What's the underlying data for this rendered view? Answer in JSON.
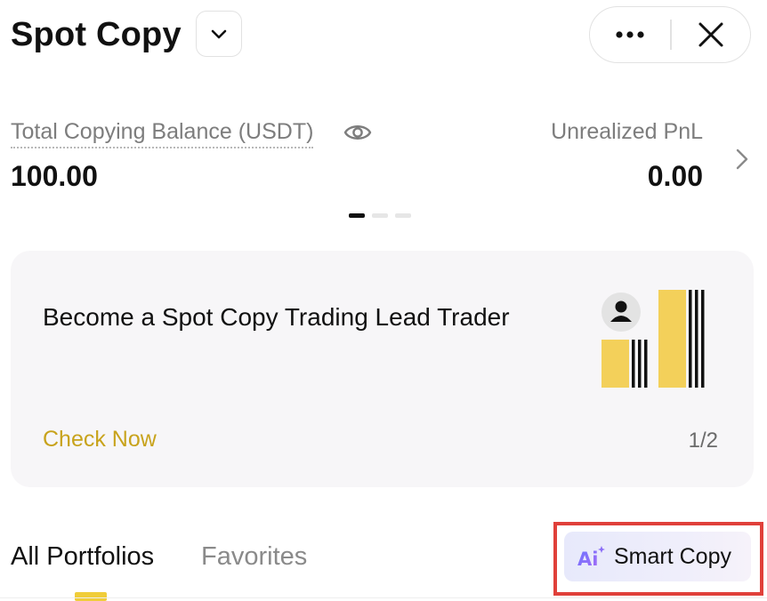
{
  "header": {
    "title": "Spot Copy"
  },
  "balance": {
    "label": "Total Copying Balance (USDT)",
    "value": "100.00"
  },
  "pnl": {
    "label": "Unrealized PnL",
    "value": "0.00"
  },
  "carousel": {
    "active_index": 0,
    "count": 3
  },
  "promo": {
    "title": "Become a Spot Copy Trading Lead Trader",
    "cta": "Check Now",
    "page": "1/2"
  },
  "tabs": {
    "all_portfolios": "All Portfolios",
    "favorites": "Favorites"
  },
  "smart_copy": {
    "icon_text": "Ai",
    "label": "Smart Copy"
  },
  "colors": {
    "accent_yellow": "#F0CD3A",
    "cta_gold": "#C8A31C",
    "highlight_red": "#E0403A"
  },
  "icons": [
    "chevron-down-icon",
    "more-icon",
    "close-icon",
    "eye-icon",
    "chevron-right-icon",
    "avatar-icon",
    "ai-sparkle-icon"
  ]
}
